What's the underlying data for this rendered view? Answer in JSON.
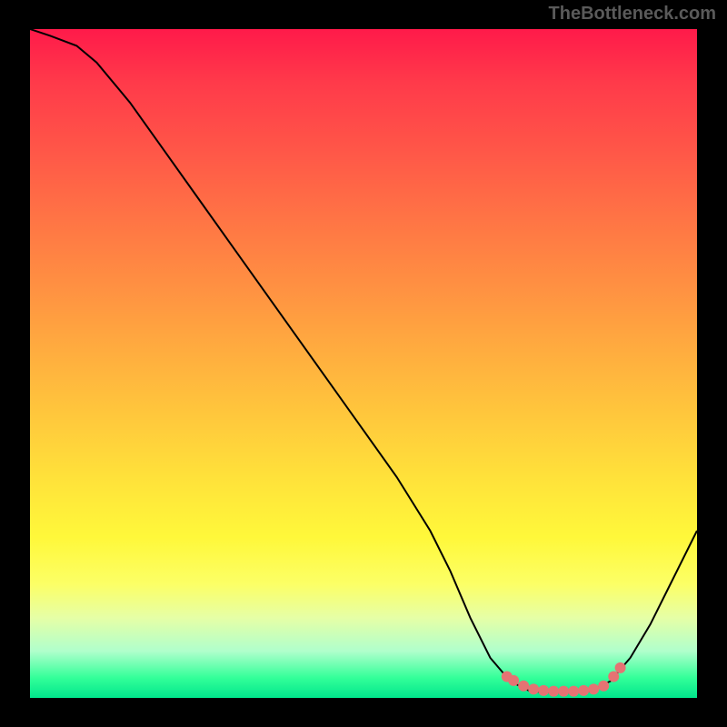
{
  "watermark": "TheBottleneck.com",
  "chart_data": {
    "type": "line",
    "title": "",
    "xlabel": "",
    "ylabel": "",
    "xlim": [
      0,
      100
    ],
    "ylim": [
      0,
      100
    ],
    "series": [
      {
        "name": "curve",
        "x": [
          0,
          3,
          7,
          10,
          15,
          20,
          25,
          30,
          35,
          40,
          45,
          50,
          55,
          60,
          63,
          66,
          69,
          72,
          75,
          78,
          81,
          84,
          87,
          90,
          93,
          96,
          100
        ],
        "y": [
          100,
          99,
          97.5,
          95,
          89,
          82,
          75,
          68,
          61,
          54,
          47,
          40,
          33,
          25,
          19,
          12,
          6,
          2.5,
          1,
          0.8,
          0.8,
          1,
          2.5,
          6,
          11,
          17,
          25
        ]
      }
    ],
    "markers": {
      "x": [
        71.5,
        72.5,
        74,
        75.5,
        77,
        78.5,
        80,
        81.5,
        83,
        84.5,
        86,
        87.5,
        88.5
      ],
      "y": [
        3.2,
        2.6,
        1.8,
        1.3,
        1.1,
        1.0,
        1.0,
        1.0,
        1.1,
        1.3,
        1.8,
        3.2,
        4.5
      ],
      "color": "#e57373",
      "size": 6
    },
    "gradient_stops": [
      {
        "offset": 0,
        "color": "#ff1a4a"
      },
      {
        "offset": 50,
        "color": "#ffc83c"
      },
      {
        "offset": 85,
        "color": "#fcff66"
      },
      {
        "offset": 100,
        "color": "#00e68c"
      }
    ]
  }
}
